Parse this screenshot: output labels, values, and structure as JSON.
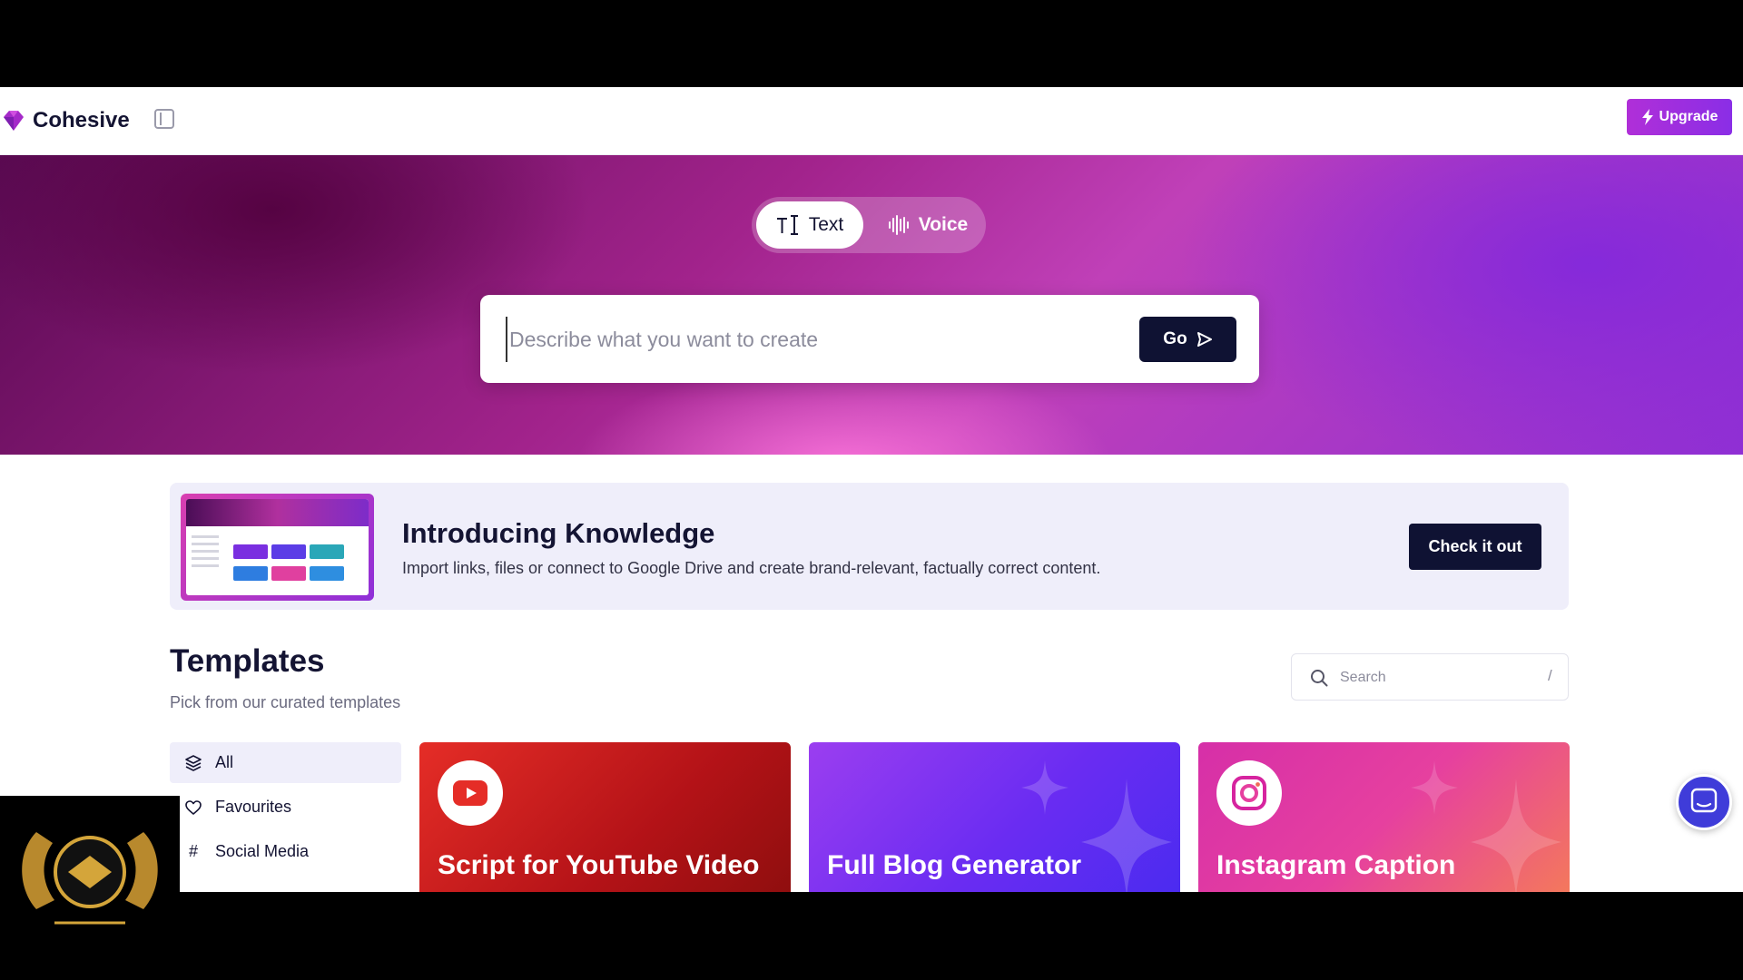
{
  "header": {
    "brand": "Cohesive",
    "upgrade_label": "Upgrade"
  },
  "hero": {
    "mode_text": "Text",
    "mode_voice": "Voice",
    "prompt_placeholder": "Describe what you want to create",
    "go_label": "Go"
  },
  "announcement": {
    "title": "Introducing Knowledge",
    "description": "Import links, files or connect to Google Drive and create brand-relevant, factually correct content.",
    "cta": "Check it out"
  },
  "templates": {
    "heading": "Templates",
    "subheading": "Pick from our curated templates",
    "search_placeholder": "Search",
    "search_shortcut": "/",
    "categories": [
      {
        "label": "All",
        "icon": "layers-icon",
        "active": true
      },
      {
        "label": "Favourites",
        "icon": "heart-icon",
        "active": false
      },
      {
        "label": "Social Media",
        "icon": "hash-icon",
        "active": false
      }
    ],
    "cards": [
      {
        "title": "Script for YouTube Video",
        "icon": "youtube-icon"
      },
      {
        "title": "Full Blog Generator",
        "icon": "sparkle-icon"
      },
      {
        "title": "Instagram Caption",
        "icon": "instagram-icon"
      }
    ]
  },
  "colors": {
    "accent": "#9b2fd8",
    "dark": "#0f1233",
    "youtube": "#d8241f",
    "blog": "#6a2cf2",
    "instagram": "#e0409f"
  }
}
